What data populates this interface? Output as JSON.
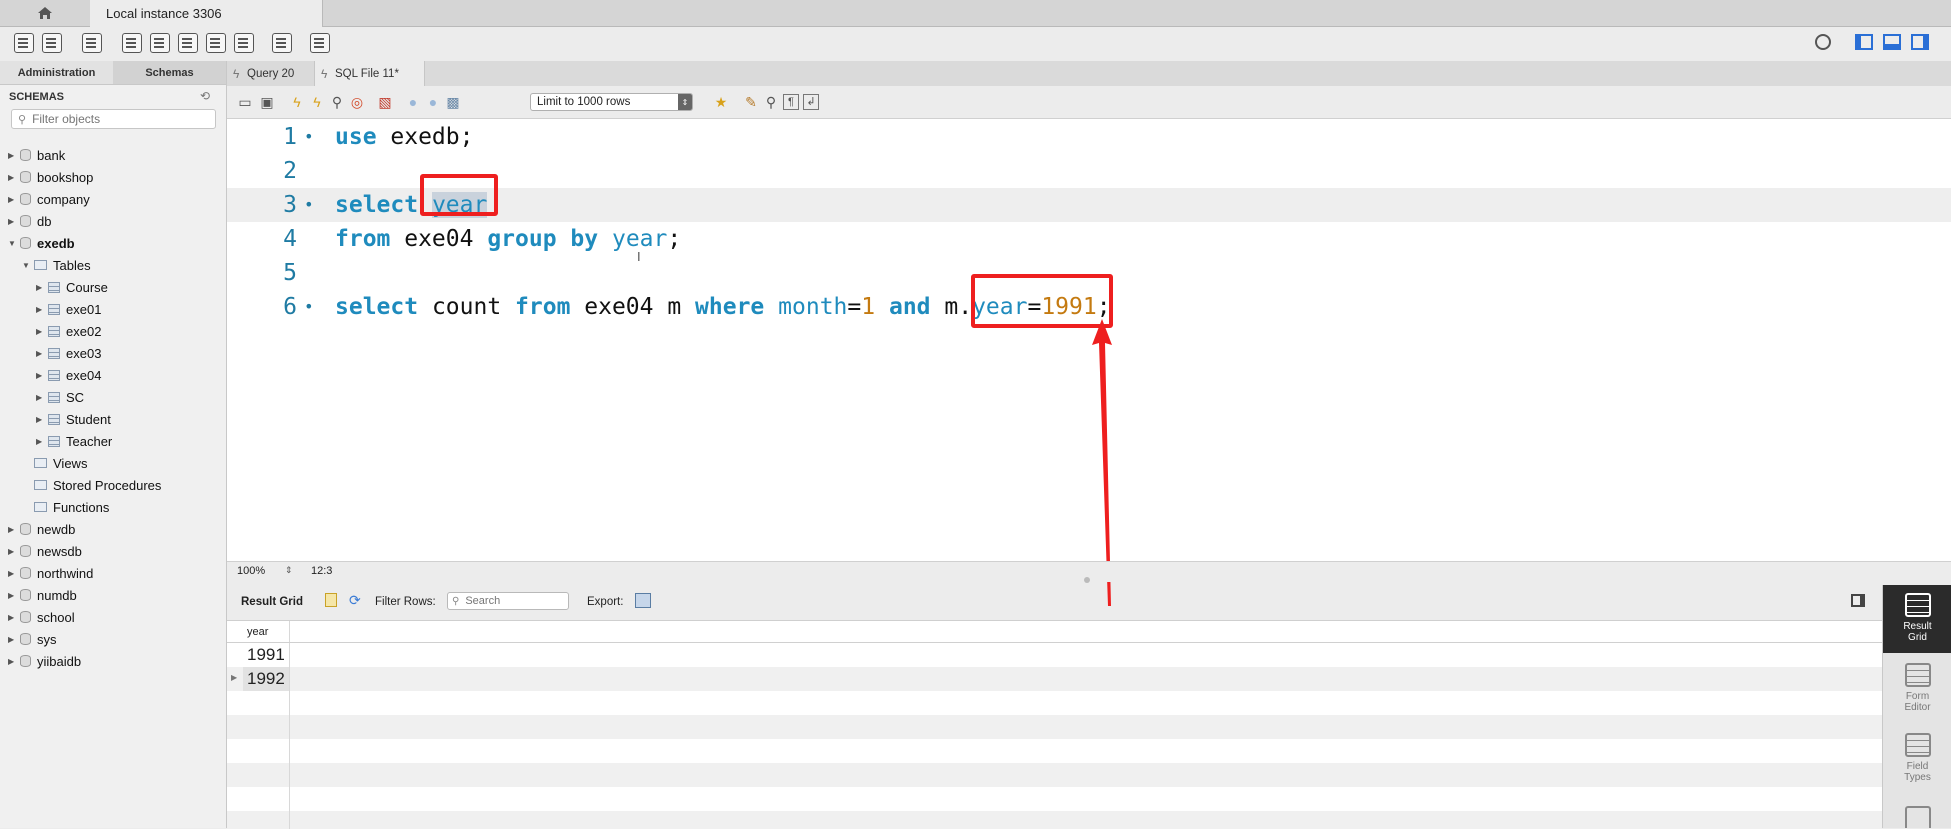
{
  "window": {
    "instance_tab": "Local instance 3306"
  },
  "sidebar": {
    "tabs": [
      "Administration",
      "Schemas"
    ],
    "active_tab": "Schemas",
    "header": "SCHEMAS",
    "filter_placeholder": "Filter objects",
    "schemas": [
      {
        "name": "bank"
      },
      {
        "name": "bookshop"
      },
      {
        "name": "company"
      },
      {
        "name": "db"
      },
      {
        "name": "exedb",
        "expanded": true,
        "tables_label": "Tables",
        "tables": [
          "Course",
          "exe01",
          "exe02",
          "exe03",
          "exe04",
          "SC",
          "Student",
          "Teacher"
        ],
        "folders": [
          "Views",
          "Stored Procedures",
          "Functions"
        ]
      },
      {
        "name": "newdb"
      },
      {
        "name": "newsdb"
      },
      {
        "name": "northwind"
      },
      {
        "name": "numdb"
      },
      {
        "name": "school"
      },
      {
        "name": "sys"
      },
      {
        "name": "yiibaidb"
      }
    ]
  },
  "editor_tabs": [
    {
      "label": "Query 20",
      "active": false
    },
    {
      "label": "SQL File 11*",
      "active": true
    }
  ],
  "sql_toolbar": {
    "limit_label": "Limit to 1000 rows"
  },
  "editor": {
    "lines": [
      {
        "num": "1",
        "dot": "•",
        "text": "use exedb;"
      },
      {
        "num": "2",
        "dot": "",
        "text": ""
      },
      {
        "num": "3",
        "dot": "•",
        "text": "select year"
      },
      {
        "num": "4",
        "dot": "",
        "text": "from exe04 group by year;"
      },
      {
        "num": "5",
        "dot": "",
        "text": ""
      },
      {
        "num": "6",
        "dot": "•",
        "text": "select count from exe04 m where month=1 and m.year=1991;"
      }
    ],
    "zoom": "100%",
    "cursor_pos": "12:3"
  },
  "results": {
    "result_grid_label": "Result Grid",
    "filter_rows_label": "Filter Rows:",
    "search_placeholder": "Search",
    "export_label": "Export:",
    "column": "year",
    "rows": [
      "1991",
      "1992"
    ]
  },
  "right_panel": [
    {
      "label": "Result\nGrid",
      "active": true
    },
    {
      "label": "Form\nEditor",
      "active": false
    },
    {
      "label": "Field\nTypes",
      "active": false
    }
  ],
  "colors": {
    "keyword": "#1f8bbd",
    "number": "#c47a10",
    "annotation": "#ee1f1f"
  }
}
